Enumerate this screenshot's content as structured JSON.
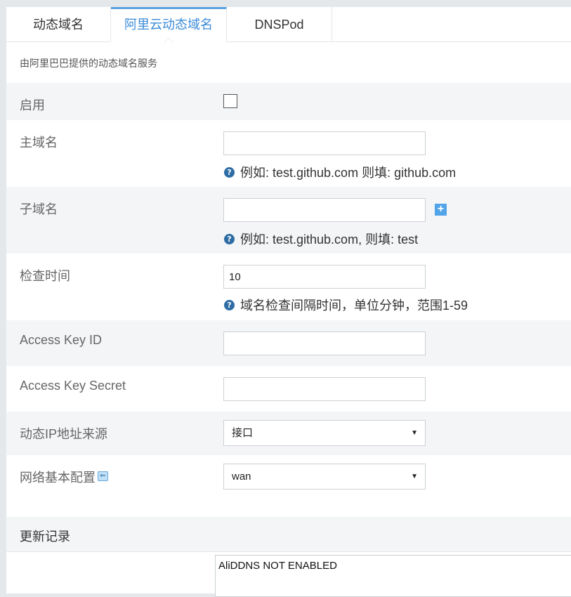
{
  "tabs": [
    {
      "label": "动态域名",
      "active": false
    },
    {
      "label": "阿里云动态域名",
      "active": true
    },
    {
      "label": "DNSPod",
      "active": false
    }
  ],
  "description": "由阿里巴巴提供的动态域名服务",
  "form": {
    "enable": {
      "label": "启用",
      "checked": false
    },
    "main_domain": {
      "label": "主域名",
      "value": "",
      "hint": "例如: test.github.com 则填: github.com"
    },
    "sub_domain": {
      "label": "子域名",
      "value": "",
      "hint": "例如: test.github.com, 则填: test",
      "add_icon": "+"
    },
    "check_time": {
      "label": "检查时间",
      "value": "10",
      "hint": "域名检查间隔时间，单位分钟，范围1-59"
    },
    "access_key_id": {
      "label": "Access Key ID",
      "value": ""
    },
    "access_key_secret": {
      "label": "Access Key Secret",
      "value": ""
    },
    "ip_source": {
      "label": "动态IP地址来源",
      "selected": "接口"
    },
    "network": {
      "label": "网络基本配置",
      "selected": "wan"
    }
  },
  "log": {
    "title": "更新记录",
    "content": "AliDDNS NOT ENABLED"
  },
  "icons": {
    "help": "?",
    "arrow": "▼",
    "back": "⇐"
  },
  "colors": {
    "accent": "#3b8bd8",
    "help_icon": "#2e6da4",
    "plus_icon": "#52a4e8"
  }
}
